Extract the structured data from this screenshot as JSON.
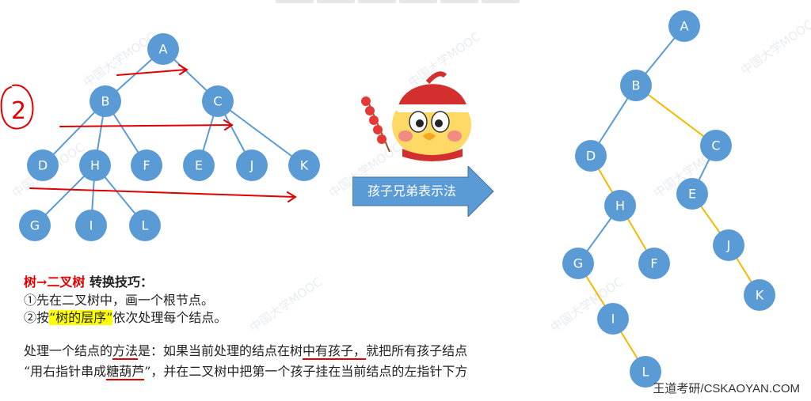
{
  "left_tree": {
    "nodes": [
      {
        "id": "A",
        "label": "A"
      },
      {
        "id": "B",
        "label": "B"
      },
      {
        "id": "C",
        "label": "C"
      },
      {
        "id": "D",
        "label": "D"
      },
      {
        "id": "H",
        "label": "H"
      },
      {
        "id": "F",
        "label": "F"
      },
      {
        "id": "E",
        "label": "E"
      },
      {
        "id": "J",
        "label": "J"
      },
      {
        "id": "K",
        "label": "K"
      },
      {
        "id": "G",
        "label": "G"
      },
      {
        "id": "I",
        "label": "I"
      },
      {
        "id": "L",
        "label": "L"
      }
    ],
    "edges": [
      [
        "A",
        "B"
      ],
      [
        "A",
        "C"
      ],
      [
        "B",
        "D"
      ],
      [
        "B",
        "H"
      ],
      [
        "B",
        "F"
      ],
      [
        "C",
        "E"
      ],
      [
        "C",
        "J"
      ],
      [
        "C",
        "K"
      ],
      [
        "H",
        "G"
      ],
      [
        "H",
        "I"
      ],
      [
        "H",
        "L"
      ]
    ],
    "annotation_number": "2"
  },
  "right_tree": {
    "nodes": [
      {
        "id": "A",
        "label": "A"
      },
      {
        "id": "B",
        "label": "B"
      },
      {
        "id": "D",
        "label": "D"
      },
      {
        "id": "C",
        "label": "C"
      },
      {
        "id": "H",
        "label": "H"
      },
      {
        "id": "E",
        "label": "E"
      },
      {
        "id": "G",
        "label": "G"
      },
      {
        "id": "F",
        "label": "F"
      },
      {
        "id": "J",
        "label": "J"
      },
      {
        "id": "I",
        "label": "I"
      },
      {
        "id": "K",
        "label": "K"
      },
      {
        "id": "L",
        "label": "L"
      }
    ],
    "left_child_edges": [
      [
        "A",
        "B"
      ],
      [
        "B",
        "D"
      ],
      [
        "C",
        "E"
      ],
      [
        "H",
        "G"
      ]
    ],
    "right_sibling_edges": [
      [
        "B",
        "C"
      ],
      [
        "D",
        "H"
      ],
      [
        "H",
        "F"
      ],
      [
        "E",
        "J"
      ],
      [
        "J",
        "K"
      ],
      [
        "G",
        "I"
      ],
      [
        "I",
        "L"
      ]
    ],
    "colors": {
      "left_child": "#5b9bd5",
      "right_sibling": "#f5b800"
    }
  },
  "arrow": {
    "label": "孩子兄弟表示法",
    "color": "#5b9bd5"
  },
  "tips": {
    "title_a": "树",
    "title_arrow": "→",
    "title_b": "二叉树",
    "title_rest": " 转换技巧：",
    "line1": "①先在二叉树中，画一个根节点。",
    "line2_pre": "②按",
    "line2_hl": "“树的层序”",
    "line2_post": "依次处理每个结点。",
    "method1_a": "处理一个结点的",
    "method1_u1": "方法",
    "method1_b": "是：如果当前处理的结点在树",
    "method1_u2": "中有孩子，",
    "method1_c": "就把所有孩子结点",
    "method2_a": "“用右指针串成",
    "method2_u": "糖葫芦",
    "method2_b": "”，并在二叉树中把第一个孩子挂在当前结点的左指针下方"
  },
  "footer": "王道考研/CSKAOYAN.COM",
  "watermark": "中国大学MOOC"
}
